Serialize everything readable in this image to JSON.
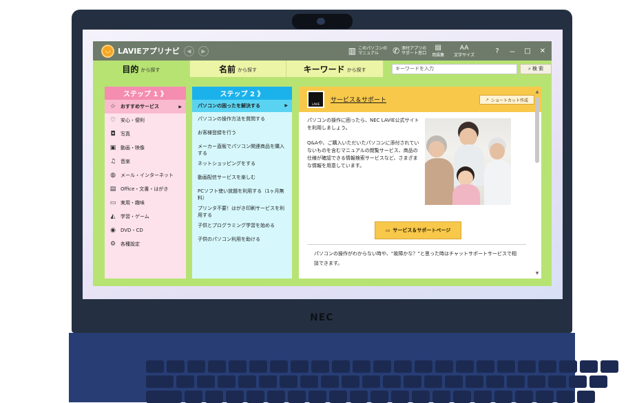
{
  "device": {
    "brand": "NEC"
  },
  "app": {
    "name": "LAVIEアプリナビ",
    "toolbar": {
      "manual": "このパソコンの\nマニュアル",
      "support": "添付アプリの\nサポート窓口",
      "glossary": "用語集",
      "fontsize_icon": "AA",
      "fontsize": "文字サイズ",
      "help": "?",
      "minimize": "－",
      "maximize": "□",
      "close": "✕"
    },
    "tabs": [
      {
        "label": "目的",
        "sub": "から探す"
      },
      {
        "label": "名前",
        "sub": "から探す"
      },
      {
        "label": "キーワード",
        "sub": "から探す"
      }
    ],
    "search": {
      "placeholder": "キーワードを入力",
      "button": "検 索"
    }
  },
  "step1": {
    "header": "ステップ 1 》",
    "items": [
      {
        "icon": "☆",
        "label": "おすすめサービス"
      },
      {
        "icon": "♡",
        "label": "安心・便利"
      },
      {
        "icon": "◘",
        "label": "写真"
      },
      {
        "icon": "▣",
        "label": "動画・映像"
      },
      {
        "icon": "♫",
        "label": "音楽"
      },
      {
        "icon": "◍",
        "label": "メール・インターネット"
      },
      {
        "icon": "▤",
        "label": "Office・文書・はがき"
      },
      {
        "icon": "▭",
        "label": "実用・趣味"
      },
      {
        "icon": "◭",
        "label": "学習・ゲーム"
      },
      {
        "icon": "◉",
        "label": "DVD・CD"
      },
      {
        "icon": "⚙",
        "label": "各種設定"
      }
    ]
  },
  "step2": {
    "header": "ステップ 2 》",
    "items": [
      "パソコンの困ったを解決する",
      "パソコンの操作方法を質問する",
      "お客様登録を行う",
      "メーカー直販でパソコン関連商品を購入する",
      "ネットショッピングをする",
      "動画配信サービスを楽しむ",
      "PCソフト使い放題を利用する（1ヶ月無料）",
      "プリンタ不要！はがき印刷サービスを利用する",
      "子供とプログラミング学習を始める",
      "子供のパソコン利用を助ける"
    ]
  },
  "detail": {
    "logo_text": "LAVIE",
    "title": "サービス＆サポート",
    "shortcut": "ショートカット作成",
    "p1": "パソコンの操作に困ったら、NEC LAVIE公式サイトを利用しましょう。",
    "p2": "Q&Aや、ご購入いただいたパソコンに添付されていないものを含むマニュアルの閲覧サービス、商品の仕様が確認できる情報検索サービスなど、さまざまな情報を用意しています。",
    "page_button": "サービス＆サポートページ",
    "p3": "パソコンの操作がわからない時や、“故障かな？”と思った時はチャットサポートサービスで相談できます。"
  }
}
